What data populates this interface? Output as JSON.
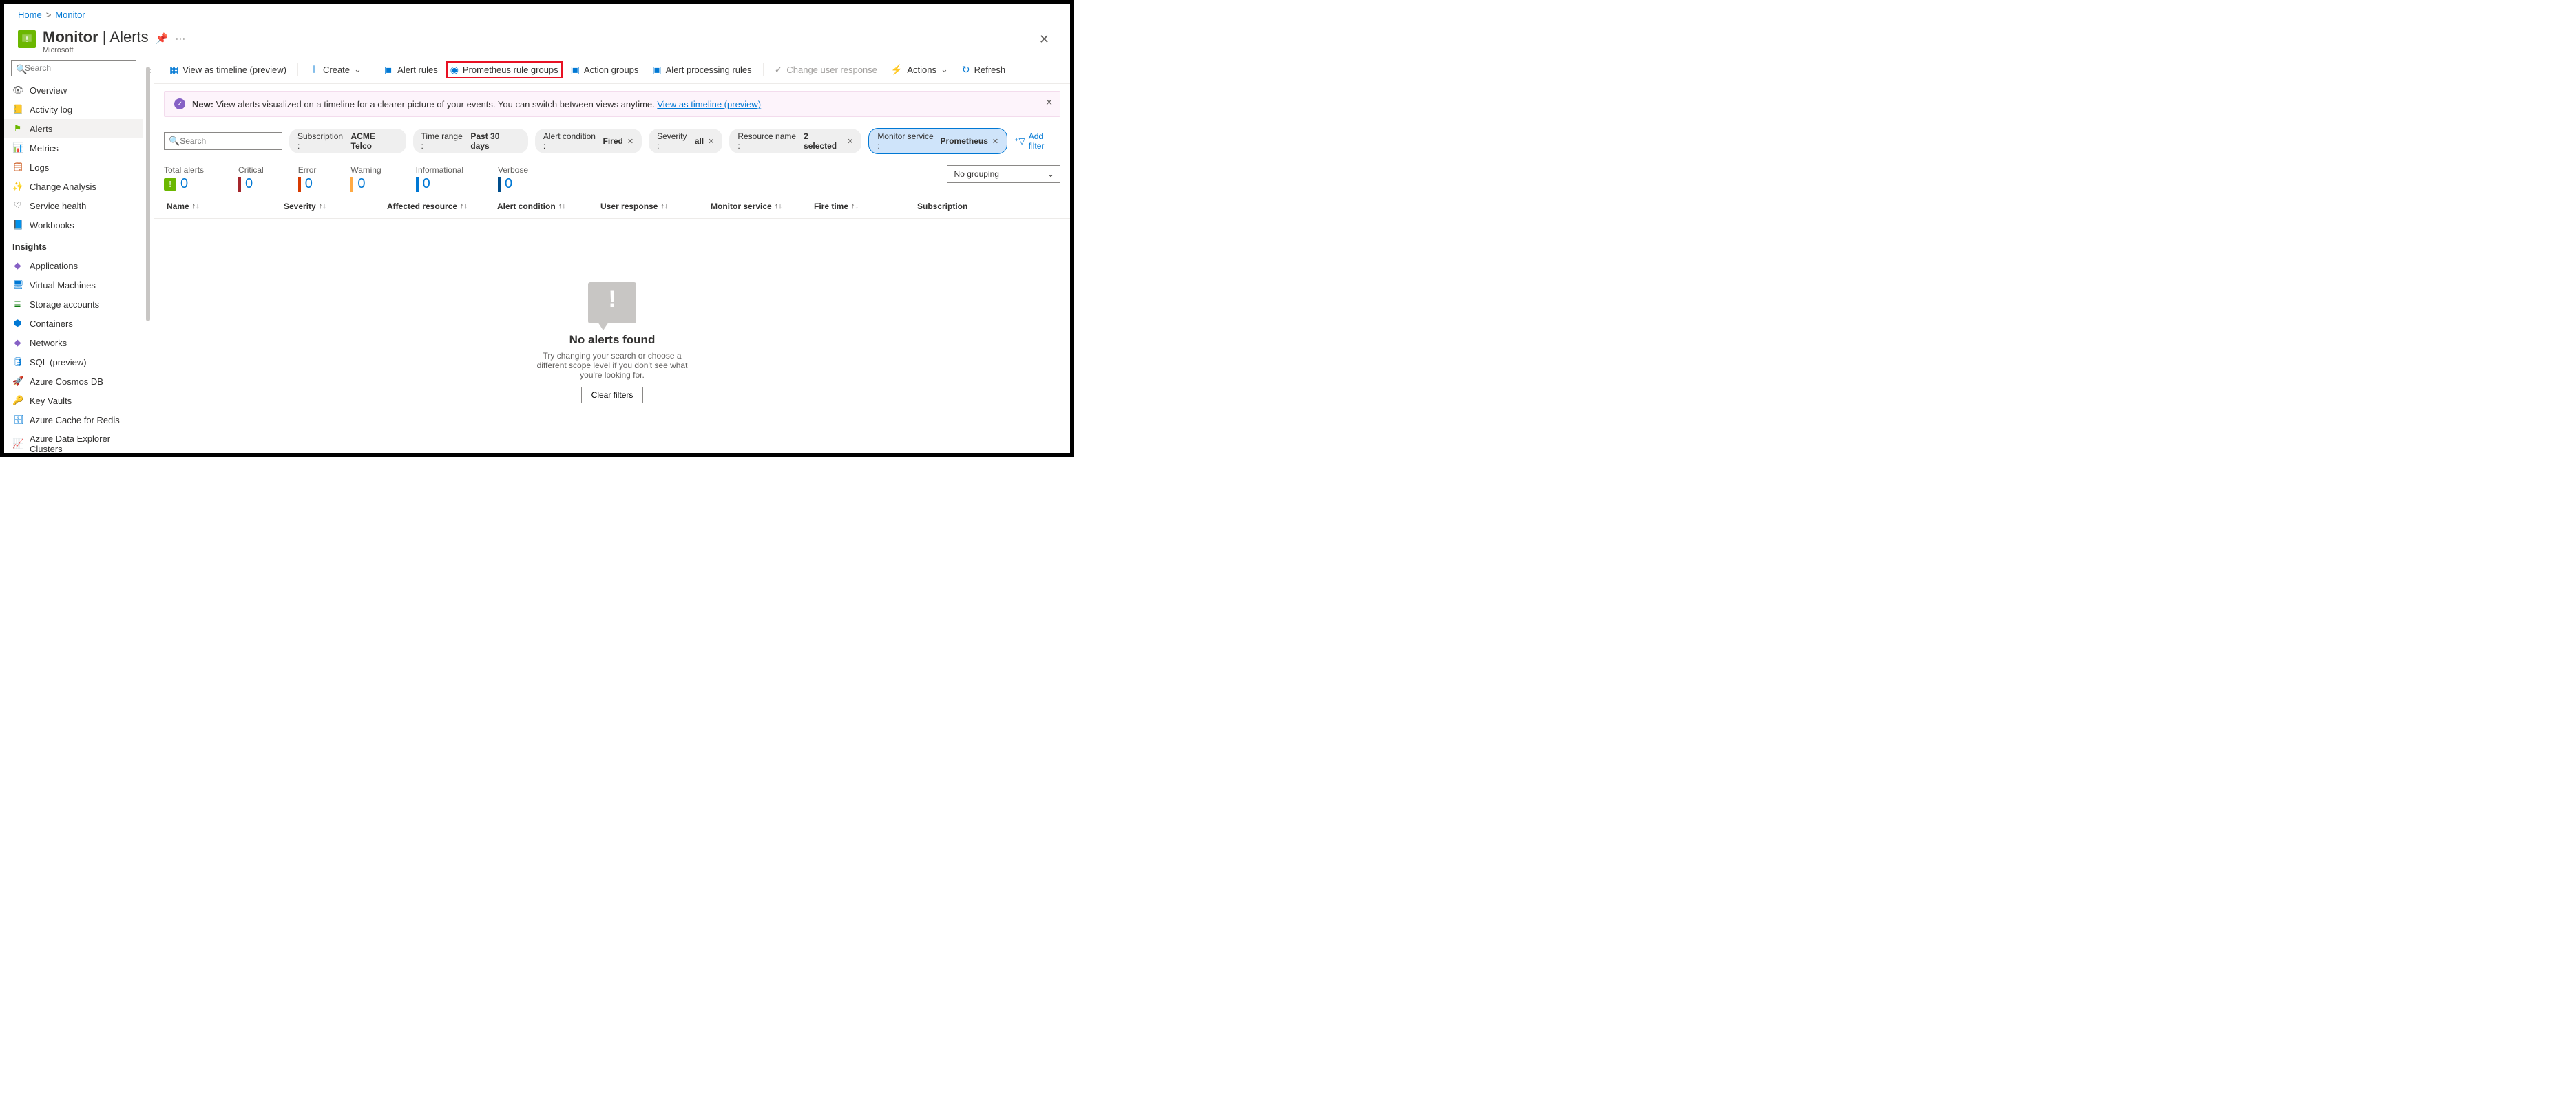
{
  "breadcrumb": {
    "home": "Home",
    "monitor": "Monitor"
  },
  "header": {
    "title": "Monitor",
    "section": "Alerts",
    "subtitle": "Microsoft"
  },
  "sidebar": {
    "search_placeholder": "Search",
    "items": [
      {
        "icon": "eye",
        "label": "Overview",
        "color": "#5c5c5c"
      },
      {
        "icon": "log",
        "label": "Activity log",
        "color": "#0078d4"
      },
      {
        "icon": "flag",
        "label": "Alerts",
        "color": "#6bb700",
        "selected": true
      },
      {
        "icon": "chart",
        "label": "Metrics",
        "color": "#0078d4"
      },
      {
        "icon": "logs",
        "label": "Logs",
        "color": "#ca5010"
      },
      {
        "icon": "change",
        "label": "Change Analysis",
        "color": "#0078d4"
      },
      {
        "icon": "heart",
        "label": "Service health",
        "color": "#5c5c5c"
      },
      {
        "icon": "book",
        "label": "Workbooks",
        "color": "#0078d4"
      }
    ],
    "insights_head": "Insights",
    "insights": [
      {
        "icon": "app",
        "label": "Applications",
        "color": "#8661c5"
      },
      {
        "icon": "vm",
        "label": "Virtual Machines",
        "color": "#0078d4"
      },
      {
        "icon": "storage",
        "label": "Storage accounts",
        "color": "#107c10"
      },
      {
        "icon": "container",
        "label": "Containers",
        "color": "#0078d4"
      },
      {
        "icon": "net",
        "label": "Networks",
        "color": "#8661c5"
      },
      {
        "icon": "sql",
        "label": "SQL (preview)",
        "color": "#0078d4"
      },
      {
        "icon": "cosmos",
        "label": "Azure Cosmos DB",
        "color": "#0078d4"
      },
      {
        "icon": "key",
        "label": "Key Vaults",
        "color": "#ffaa44"
      },
      {
        "icon": "redis",
        "label": "Azure Cache for Redis",
        "color": "#0078d4"
      },
      {
        "icon": "adx",
        "label": "Azure Data Explorer Clusters",
        "color": "#0078d4"
      }
    ]
  },
  "toolbar": {
    "view_timeline": "View as timeline (preview)",
    "create": "Create",
    "alert_rules": "Alert rules",
    "prom_groups": "Prometheus rule groups",
    "action_groups": "Action groups",
    "alert_processing": "Alert processing rules",
    "change_user_response": "Change user response",
    "actions": "Actions",
    "refresh": "Refresh"
  },
  "notice": {
    "bold": "New:",
    "text": " View alerts visualized on a timeline for a clearer picture of your events. You can switch between views anytime. ",
    "link": "View as timeline (preview)"
  },
  "filters": {
    "search_placeholder": "Search",
    "subscription": {
      "k": "Subscription : ",
      "v": "ACME Telco"
    },
    "time_range": {
      "k": "Time range : ",
      "v": "Past 30 days"
    },
    "alert_condition": {
      "k": "Alert condition : ",
      "v": "Fired"
    },
    "severity": {
      "k": "Severity : ",
      "v": "all"
    },
    "resource_name": {
      "k": "Resource name : ",
      "v": "2 selected"
    },
    "monitor_service": {
      "k": "Monitor service : ",
      "v": "Prometheus"
    },
    "add_filter": "Add filter"
  },
  "summary": [
    {
      "label": "Total alerts",
      "value": "0",
      "type": "flag",
      "color": "#6bb700"
    },
    {
      "label": "Critical",
      "value": "0",
      "color": "#a4262c"
    },
    {
      "label": "Error",
      "value": "0",
      "color": "#d83b01"
    },
    {
      "label": "Warning",
      "value": "0",
      "color": "#ffaa44"
    },
    {
      "label": "Informational",
      "value": "0",
      "color": "#0078d4"
    },
    {
      "label": "Verbose",
      "value": "0",
      "color": "#004e8c"
    }
  ],
  "grouping": "No grouping",
  "columns": [
    "Name",
    "Severity",
    "Affected resource",
    "Alert condition",
    "User response",
    "Monitor service",
    "Fire time",
    "Subscription"
  ],
  "empty": {
    "title": "No alerts found",
    "text": "Try changing your search or choose a different scope level if you don't see what you're looking for.",
    "button": "Clear filters"
  }
}
